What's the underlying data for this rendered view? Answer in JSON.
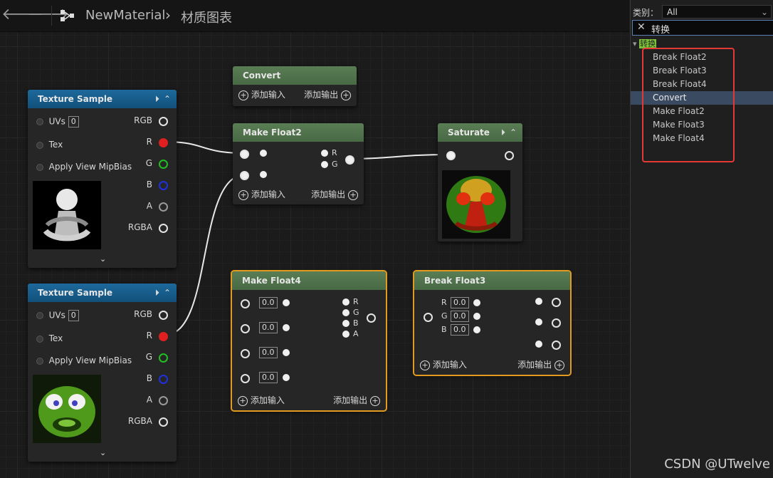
{
  "breadcrumb": {
    "asset": "NewMaterial",
    "separator": "›",
    "page": "材质图表"
  },
  "nodes": {
    "tex1": {
      "title": "Texture Sample",
      "uvs": "UVs",
      "uv_value": "0",
      "tex": "Tex",
      "mip": "Apply View MipBias",
      "out": [
        "RGB",
        "R",
        "G",
        "B",
        "A",
        "RGBA"
      ]
    },
    "tex2": {
      "title": "Texture Sample",
      "uvs": "UVs",
      "uv_value": "0",
      "tex": "Tex",
      "mip": "Apply View MipBias",
      "out": [
        "RGB",
        "R",
        "G",
        "B",
        "A",
        "RGBA"
      ]
    },
    "convert": {
      "title": "Convert",
      "add_in": "添加输入",
      "add_out": "添加输出"
    },
    "mf2": {
      "title": "Make Float2",
      "pins": [
        "R",
        "G"
      ],
      "add_in": "添加输入",
      "add_out": "添加输出"
    },
    "saturate": {
      "title": "Saturate"
    },
    "mf4": {
      "title": "Make Float4",
      "values": [
        "0.0",
        "0.0",
        "0.0",
        "0.0"
      ],
      "pins": [
        "R",
        "G",
        "B",
        "A"
      ],
      "add_in": "添加输入",
      "add_out": "添加输出"
    },
    "bf3": {
      "title": "Break Float3",
      "pins": [
        "R",
        "G",
        "B"
      ],
      "values": [
        "0.0",
        "0.0",
        "0.0"
      ],
      "add_in": "添加输入",
      "add_out": "添加输出"
    }
  },
  "panel": {
    "category_label": "类别：",
    "category_value": "All",
    "search_text": "转换",
    "group": "转换",
    "items": [
      "Break Float2",
      "Break Float3",
      "Break Float4",
      "Convert",
      "Make Float2",
      "Make Float3",
      "Make Float4"
    ],
    "active_index": 3
  },
  "colors": {
    "pin_red": "#e02020",
    "pin_green": "#20c020",
    "pin_blue": "#2030e0",
    "selection": "#e39b1f",
    "highlight": "#7cc53a"
  },
  "watermark": "CSDN @UTwelve"
}
